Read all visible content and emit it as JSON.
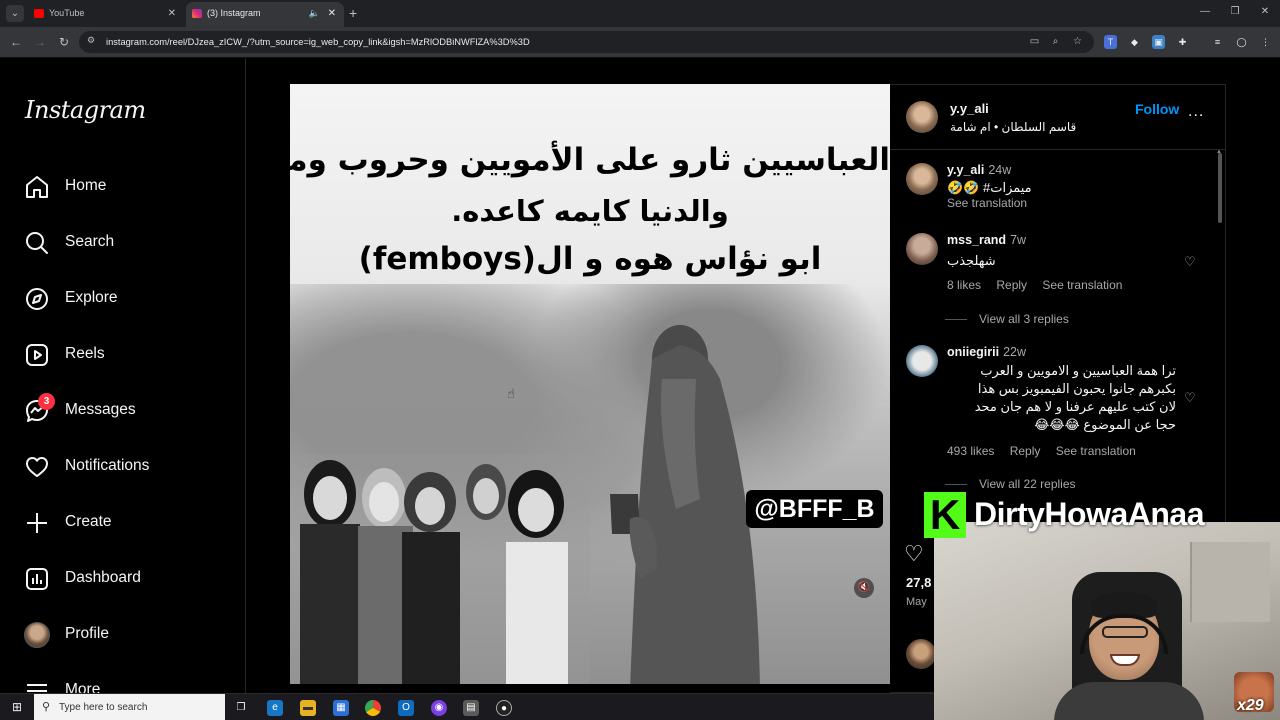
{
  "browser": {
    "tabs": [
      {
        "title": "YouTube",
        "active": false
      },
      {
        "title": "(3) Instagram",
        "active": true
      }
    ],
    "url": "instagram.com/reel/DJzea_zICW_/?utm_source=ig_web_copy_link&igsh=MzRlODBiNWFlZA%3D%3D"
  },
  "sidebar": {
    "logo": "Instagram",
    "items": [
      {
        "label": "Home",
        "icon": "home-icon"
      },
      {
        "label": "Search",
        "icon": "search-icon"
      },
      {
        "label": "Explore",
        "icon": "compass-icon"
      },
      {
        "label": "Reels",
        "icon": "reels-icon"
      },
      {
        "label": "Messages",
        "icon": "messenger-icon",
        "badge": "3"
      },
      {
        "label": "Notifications",
        "icon": "heart-icon"
      },
      {
        "label": "Create",
        "icon": "plus-icon"
      },
      {
        "label": "Dashboard",
        "icon": "dashboard-icon"
      },
      {
        "label": "Profile",
        "icon": "avatar"
      },
      {
        "label": "More",
        "icon": "menu-icon"
      }
    ]
  },
  "reel": {
    "caption_lines": [
      "العباسيين ثارو على الأمويين وحروب ومجازر",
      "والدنيا كايمه كاعده.",
      "ابو نؤاس هوه و ال(femboys)"
    ],
    "watermark": "@BFFF_B"
  },
  "post": {
    "username": "y.y_ali",
    "subtitle": "قاسم السلطان • ام شامة",
    "follow_label": "Follow",
    "more_label": "...",
    "comments": [
      {
        "user": "y.y_ali",
        "time": "24w",
        "text": "🤣🤣 #ميمزات",
        "meta": [
          "See translation"
        ]
      },
      {
        "user": "mss_rand",
        "time": "7w",
        "text": "شهلجذب",
        "meta": [
          "8 likes",
          "Reply",
          "See translation"
        ],
        "replies": "View all 3 replies"
      },
      {
        "user": "oniiegirii",
        "time": "22w",
        "text_lines": [
          "ترا همة العباسيين و الامويين و العرب",
          "بكبرهم جانوا يحبون الفيمبويز بس هذا",
          "لان كتب عليهم عرفنا و لا هم جان محد",
          "حجا عن الموضوع 😂😂😂"
        ],
        "meta": [
          "493 likes",
          "Reply",
          "See translation"
        ],
        "replies": "View all 22 replies"
      }
    ],
    "likes": "27,8",
    "date": "May"
  },
  "stream": {
    "channel": "DirtyHowaAnaa",
    "logo": "K",
    "multiplier": "x29"
  },
  "taskbar": {
    "search_placeholder": "Type here to search"
  }
}
